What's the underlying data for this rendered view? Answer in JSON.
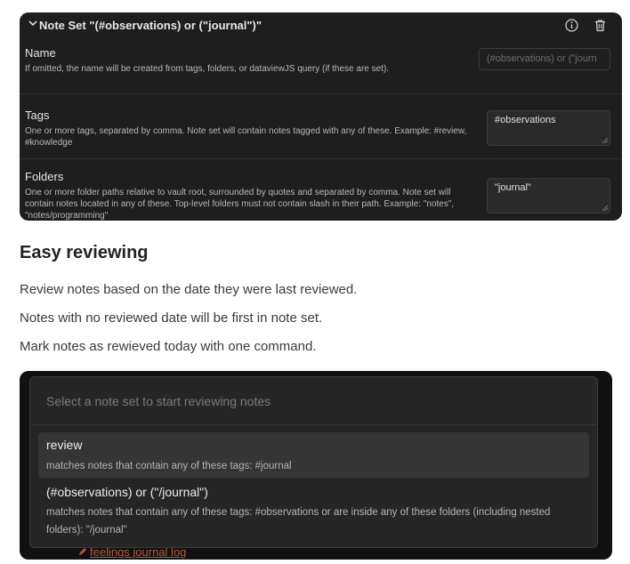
{
  "panel": {
    "title": "Note Set \"(#observations) or (\"journal\")\"",
    "settings": [
      {
        "name": "Name",
        "description": "If omitted, the name will be created from tags, folders, or dataviewJS query (if these are set).",
        "placeholder": "(#observations) or (\"journ"
      },
      {
        "name": "Tags",
        "description": "One or more tags, separated by comma. Note set will contain notes tagged with any of these. Example: #review, #knowledge",
        "value": "#observations"
      },
      {
        "name": "Folders",
        "description": "One or more folder paths relative to vault root, surrounded by quotes and separated by comma. Note set will contain notes located in any of these. Top-level folders must not contain slash in their path. Example: \"notes\", \"notes/programming\"",
        "value": "\"journal\""
      }
    ]
  },
  "section": {
    "heading": "Easy reviewing",
    "paragraphs": [
      "Review notes based on the date they were last reviewed.",
      "Notes with no reviewed date will be first in note set.",
      "Mark notes as rewieved today with one command."
    ]
  },
  "modal": {
    "placeholder": "Select a note set to start reviewing notes",
    "suggestions": [
      {
        "title": "review",
        "description": "matches notes that contain any of these tags: #journal"
      },
      {
        "title": "(#observations) or (\"/journal\")",
        "description": "matches notes that contain any of these tags: #observations or are inside any of these folders (including nested folders): \"/journal\""
      }
    ],
    "background_link": "feelings journal log"
  },
  "colors": {
    "panel_bg": "#1e1e1e",
    "modal_bg": "#262626",
    "selected_bg": "#353535",
    "link": "#b25a3a"
  }
}
